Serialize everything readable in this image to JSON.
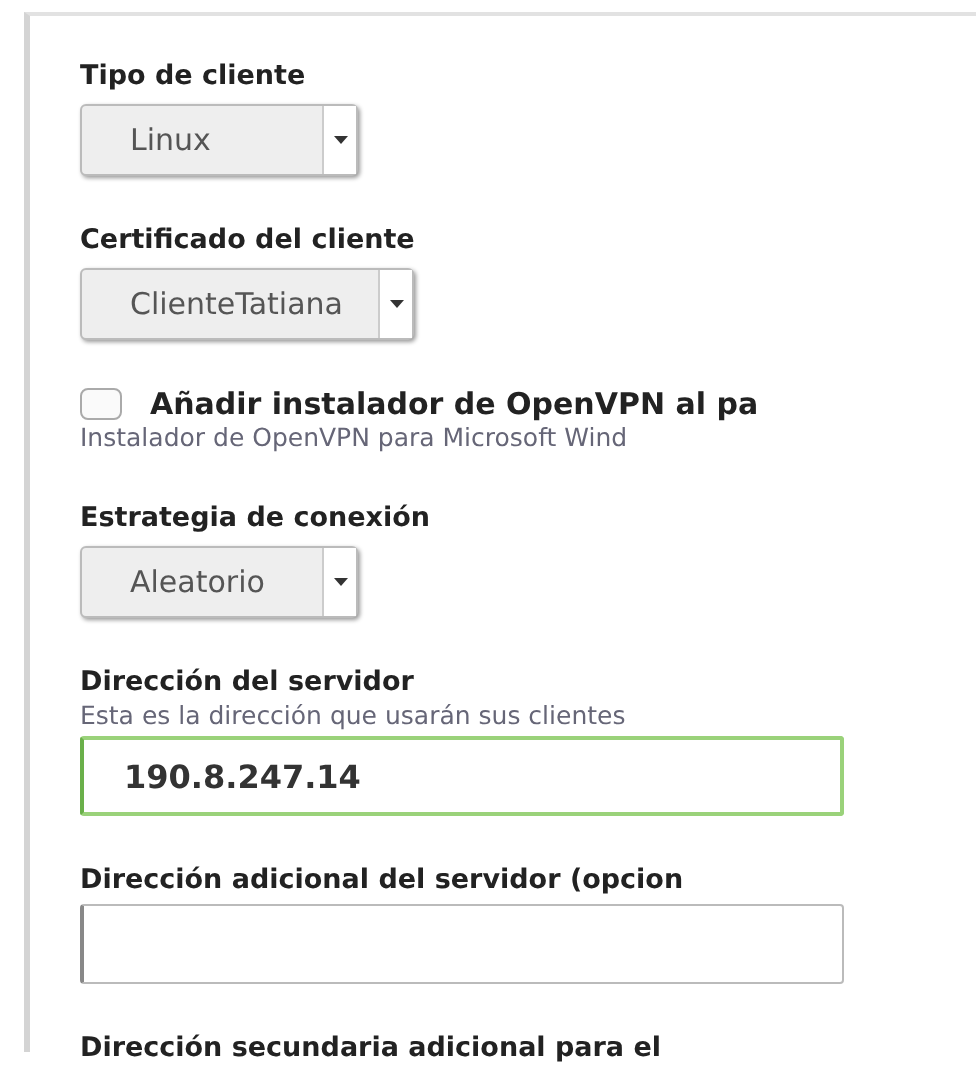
{
  "fields": [
    {
      "kind": "select",
      "label": "Tipo de cliente",
      "value": "Linux"
    },
    {
      "kind": "select",
      "label": "Certificado del cliente",
      "value": "ClienteTatiana"
    },
    {
      "kind": "checkbox",
      "label": "Añadir instalador de OpenVPN al pa",
      "description": "Instalador de OpenVPN para Microsoft Wind",
      "checked": false
    },
    {
      "kind": "select",
      "label": "Estrategia de conexión",
      "value": "Aleatorio"
    },
    {
      "kind": "text",
      "label": "Dirección del servidor",
      "description": "Esta es la dirección que usarán sus clientes",
      "value": "190.8.247.14",
      "focused": true
    },
    {
      "kind": "text",
      "label": "Dirección adicional del servidor (opcion",
      "focused": false
    },
    {
      "kind": "heading",
      "label": "Dirección secundaria adicional para el"
    }
  ]
}
